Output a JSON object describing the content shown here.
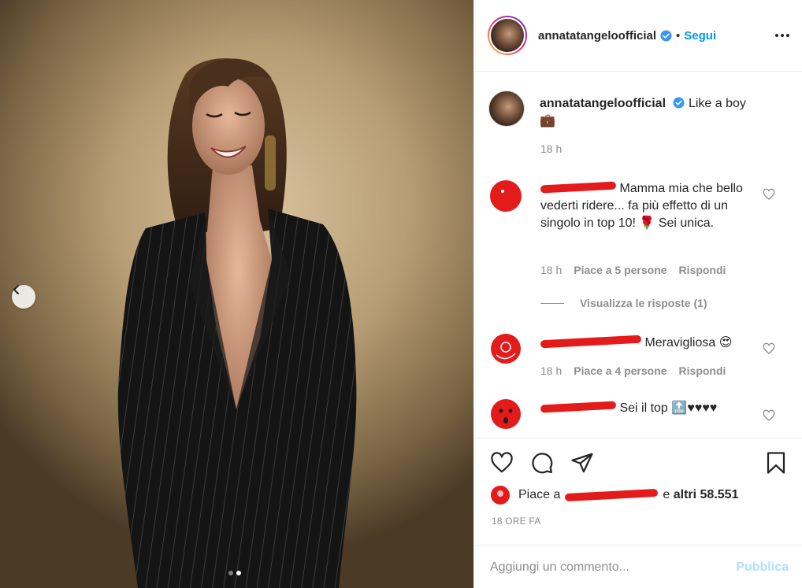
{
  "post": {
    "username": "annatatangeloofficial",
    "separator": "•",
    "follow_label": "Segui",
    "caption_text": "Like a boy",
    "caption_emoji": "💼",
    "caption_time": "18 h",
    "carousel": {
      "slide_count": 2,
      "active_slide": 2
    }
  },
  "comments": [
    {
      "text": "Mamma mia che bello vederti ridere... fa più effetto di un singolo in top 10! 🌹 Sei unica.",
      "time": "18 h",
      "likes": "Piace a 5 persone",
      "reply": "Rispondi",
      "view_replies": "Visualizza le risposte (1)"
    },
    {
      "text": "Meravigliosa 😍",
      "time": "18 h",
      "likes": "Piace a 4 persone",
      "reply": "Rispondi"
    },
    {
      "text": "Sei il top 🔝♥♥♥♥"
    }
  ],
  "likes": {
    "prefix": "Piace a",
    "connector": "e",
    "others": "altri 58.551"
  },
  "posted_time": "18 ORE FA",
  "add_comment": {
    "placeholder": "Aggiungi un commento...",
    "publish_label": "Pubblica"
  },
  "colors": {
    "accent": "#0095f6",
    "publish_disabled": "#b2dffc",
    "redaction": "#e41b1b",
    "text": "#262626",
    "muted": "#8e8e8e"
  },
  "icons": [
    "chevron-left-icon",
    "verified-badge-icon",
    "more-icon",
    "heart-icon",
    "comment-icon",
    "share-icon",
    "bookmark-icon"
  ]
}
